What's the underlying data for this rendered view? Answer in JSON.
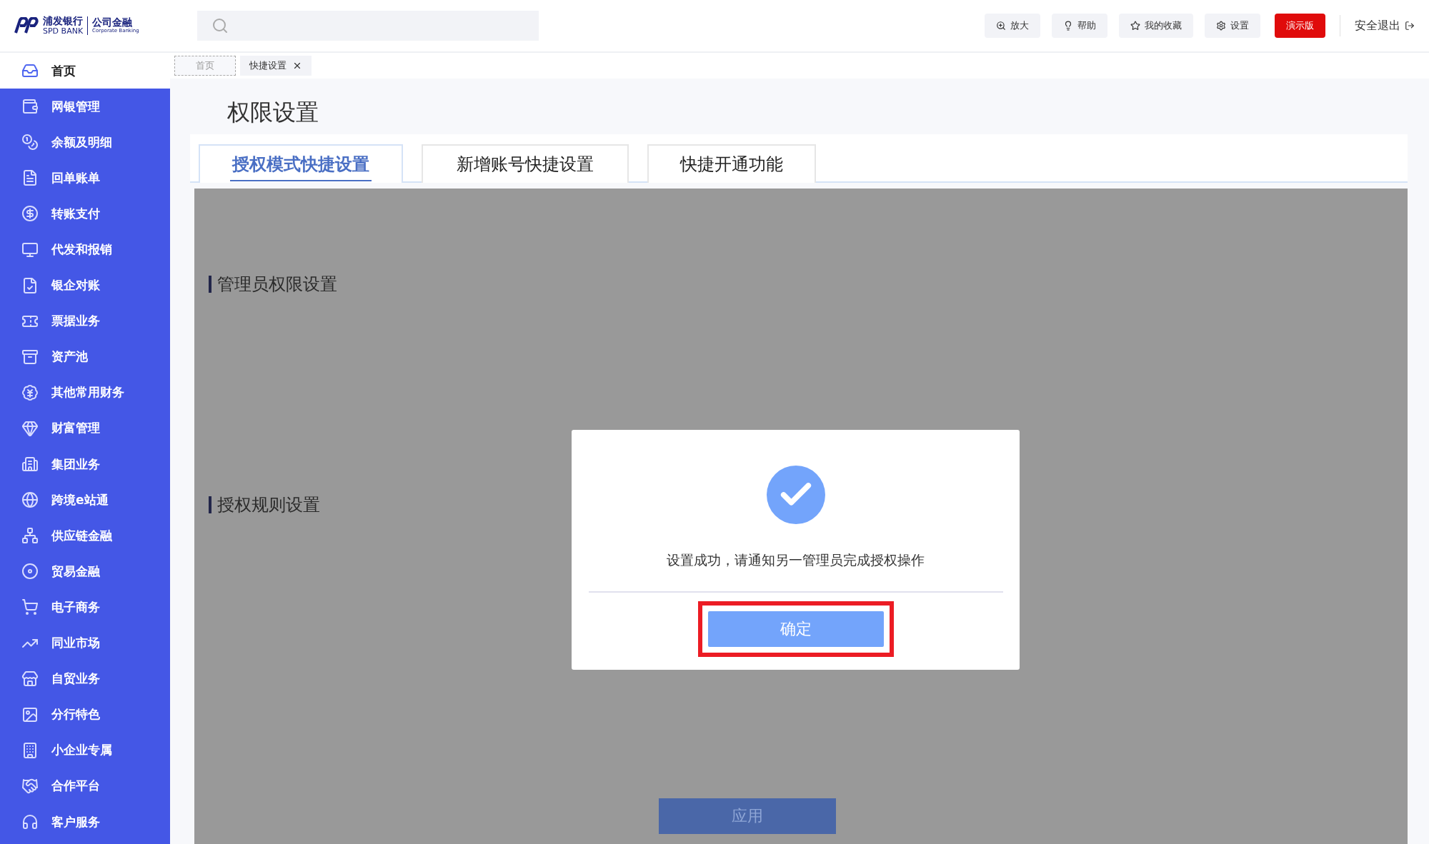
{
  "header": {
    "logo": {
      "name_cn": "浦发银行",
      "name_en": "SPD BANK",
      "division_cn": "公司金融",
      "division_en": "Corporate Banking"
    },
    "actions": [
      {
        "label": "放大",
        "kind": "zoom"
      },
      {
        "label": "帮助",
        "kind": "help"
      },
      {
        "label": "我的收藏",
        "kind": "favorite"
      },
      {
        "label": "设置",
        "kind": "settings"
      }
    ],
    "demo_badge": "演示版",
    "logout": "安全退出"
  },
  "open_tabs": [
    {
      "label": "首页",
      "selected": false,
      "closable": false
    },
    {
      "label": "快捷设置",
      "selected": true,
      "closable": true
    }
  ],
  "sidebar": {
    "items": [
      {
        "label": "首页",
        "selected": true
      },
      {
        "label": "网银管理",
        "selected": false
      },
      {
        "label": "余额及明细",
        "selected": false
      },
      {
        "label": "回单账单",
        "selected": false
      },
      {
        "label": "转账支付",
        "selected": false
      },
      {
        "label": "代发和报销",
        "selected": false
      },
      {
        "label": "银企对账",
        "selected": false
      },
      {
        "label": "票据业务",
        "selected": false
      },
      {
        "label": "资产池",
        "selected": false
      },
      {
        "label": "其他常用财务",
        "selected": false
      },
      {
        "label": "财富管理",
        "selected": false
      },
      {
        "label": "集团业务",
        "selected": false
      },
      {
        "label": "跨境e站通",
        "selected": false
      },
      {
        "label": "供应链金融",
        "selected": false
      },
      {
        "label": "贸易金融",
        "selected": false
      },
      {
        "label": "电子商务",
        "selected": false
      },
      {
        "label": "同业市场",
        "selected": false
      },
      {
        "label": "自贸业务",
        "selected": false
      },
      {
        "label": "分行特色",
        "selected": false
      },
      {
        "label": "小企业专属",
        "selected": false
      },
      {
        "label": "合作平台",
        "selected": false
      },
      {
        "label": "客户服务",
        "selected": false
      }
    ]
  },
  "page": {
    "title": "权限设置",
    "tabs": [
      {
        "label": "授权模式快捷设置",
        "selected": true
      },
      {
        "label": "新增账号快捷设置",
        "selected": false
      },
      {
        "label": "快捷开通功能",
        "selected": false
      }
    ],
    "sections": [
      {
        "title": "管理员权限设置"
      },
      {
        "title": "授权规则设置"
      }
    ],
    "apply_button": "应用"
  },
  "dialog": {
    "message": "设置成功，请通知另一管理员完成授权操作",
    "confirm": {
      "label": "确定",
      "highlighted": true
    }
  }
}
